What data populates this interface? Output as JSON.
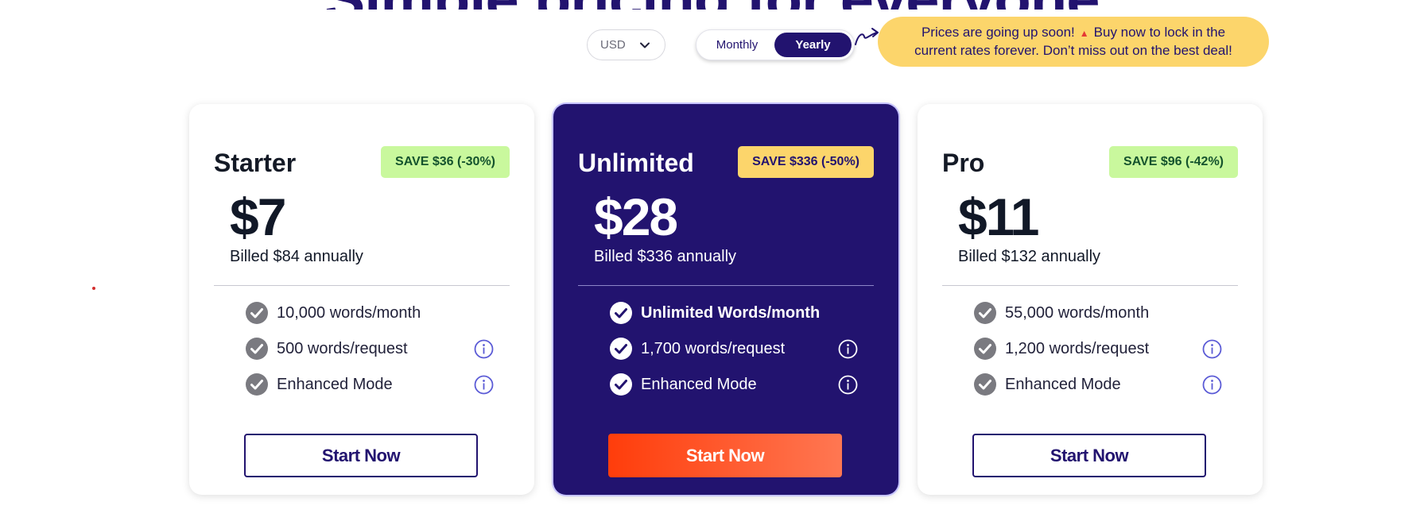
{
  "heading": "Simple pricing for everyone",
  "currency": {
    "value": "USD"
  },
  "billing_toggle": {
    "monthly": "Monthly",
    "yearly": "Yearly",
    "selected": "Yearly"
  },
  "promo": {
    "line1": "Prices are going up soon!",
    "line1b": "Buy now to lock in the",
    "line2": "current rates forever. Don’t miss out on the best deal!",
    "icon": "siren-icon"
  },
  "plans": [
    {
      "name": "Starter",
      "badge": "SAVE $36 (-30%)",
      "price": "$7",
      "billed": "Billed $84 annually",
      "features": [
        "10,000 words/month",
        "500 words/request",
        "Enhanced Mode"
      ],
      "button": "Start Now"
    },
    {
      "name": "Unlimited",
      "badge": "SAVE $336 (-50%)",
      "price": "$28",
      "billed": "Billed $336 annually",
      "features": [
        "Unlimited Words/month",
        "1,700 words/request",
        "Enhanced Mode"
      ],
      "button": "Start Now"
    },
    {
      "name": "Pro",
      "badge": "SAVE $96 (-42%)",
      "price": "$11",
      "billed": "Billed $132 annually",
      "features": [
        "55,000 words/month",
        "1,200 words/request",
        "Enhanced Mode"
      ],
      "button": "Start Now"
    }
  ],
  "colors": {
    "brand": "#22136f",
    "promo": "#fcd56b",
    "badge_green": "#c9f89d",
    "cta_start": "#ff3d0b",
    "cta_end": "#ff7752",
    "highlight_text": "#ffb8a1"
  }
}
